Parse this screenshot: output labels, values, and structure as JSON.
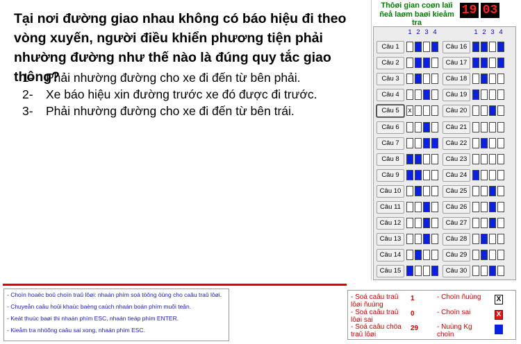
{
  "question": {
    "text": "Tại nơi đường giao nhau không có báo hiệu đi theo vòng xuyến, người điều khiển phương tiện phải nhường đường như thế nào là đúng quy tắc giao thông?",
    "answers": [
      {
        "num": "1-",
        "text": "Phải nhường đường cho xe đi đến từ bên phải."
      },
      {
        "num": "2-",
        "text": "Xe báo hiệu xin đường trước xe đó được đi trước."
      },
      {
        "num": "3-",
        "text": "Phải nhường đường cho xe đi đến từ bên trái."
      }
    ]
  },
  "timer": {
    "label": "Thôøi gian coøn laïi ñeå laøm baøi kieåm tra",
    "minutes": "19",
    "seconds": "03"
  },
  "grid": {
    "column_headers": [
      "1",
      "2",
      "3",
      "4"
    ],
    "questions": [
      {
        "label": "Câu 1",
        "cells": [
          "",
          "filled",
          "",
          "filled"
        ]
      },
      {
        "label": "Câu 2",
        "cells": [
          "",
          "filled",
          "filled",
          ""
        ]
      },
      {
        "label": "Câu 3",
        "cells": [
          "",
          "filled",
          "",
          ""
        ]
      },
      {
        "label": "Câu 4",
        "cells": [
          "",
          "",
          "filled",
          ""
        ]
      },
      {
        "label": "Câu 5",
        "cells": [
          "x",
          "",
          "",
          ""
        ],
        "active": true
      },
      {
        "label": "Câu 6",
        "cells": [
          "",
          "",
          "filled",
          ""
        ]
      },
      {
        "label": "Câu 7",
        "cells": [
          "",
          "",
          "filled",
          "filled"
        ]
      },
      {
        "label": "Câu 8",
        "cells": [
          "filled",
          "filled",
          "",
          ""
        ]
      },
      {
        "label": "Câu 9",
        "cells": [
          "filled",
          "filled",
          "",
          ""
        ]
      },
      {
        "label": "Câu 10",
        "cells": [
          "",
          "filled",
          "",
          ""
        ]
      },
      {
        "label": "Câu 11",
        "cells": [
          "",
          "",
          "filled",
          ""
        ]
      },
      {
        "label": "Câu 12",
        "cells": [
          "",
          "",
          "filled",
          ""
        ]
      },
      {
        "label": "Câu 13",
        "cells": [
          "",
          "",
          "filled",
          ""
        ]
      },
      {
        "label": "Câu 14",
        "cells": [
          "",
          "filled",
          "",
          ""
        ]
      },
      {
        "label": "Câu 15",
        "cells": [
          "filled",
          "",
          "",
          "filled"
        ]
      },
      {
        "label": "Câu 16",
        "cells": [
          "filled",
          "filled",
          "",
          "filled"
        ]
      },
      {
        "label": "Câu 17",
        "cells": [
          "filled",
          "filled",
          "",
          "filled"
        ]
      },
      {
        "label": "Câu 18",
        "cells": [
          "",
          "filled",
          "",
          ""
        ]
      },
      {
        "label": "Câu 19",
        "cells": [
          "filled",
          "",
          "",
          ""
        ]
      },
      {
        "label": "Câu 20",
        "cells": [
          "",
          "",
          "filled",
          ""
        ]
      },
      {
        "label": "Câu 21",
        "cells": [
          "",
          "",
          "",
          ""
        ]
      },
      {
        "label": "Câu 22",
        "cells": [
          "",
          "filled",
          "",
          ""
        ]
      },
      {
        "label": "Câu 23",
        "cells": [
          "",
          "",
          "",
          ""
        ]
      },
      {
        "label": "Câu 24",
        "cells": [
          "filled",
          "",
          "",
          ""
        ]
      },
      {
        "label": "Câu 25",
        "cells": [
          "",
          "",
          "filled",
          ""
        ]
      },
      {
        "label": "Câu 26",
        "cells": [
          "",
          "",
          "filled",
          ""
        ]
      },
      {
        "label": "Câu 27",
        "cells": [
          "",
          "",
          "filled",
          ""
        ]
      },
      {
        "label": "Câu 28",
        "cells": [
          "",
          "filled",
          "",
          ""
        ]
      },
      {
        "label": "Câu 29",
        "cells": [
          "",
          "filled",
          "",
          ""
        ]
      },
      {
        "label": "Câu 30",
        "cells": [
          "",
          "",
          "filled",
          ""
        ]
      }
    ]
  },
  "instructions": [
    "- Choïn hoaëc boû choïn traû lôøi: nhaán phím soá töông öùng cho caâu traû lôøi.",
    "- Chuyeån caâu hoûi khaùc baèng caùch nhaán boán phím muõi teân.",
    "- Keát thuùc baøi thi nhaán phím ESC, nhaán tieáp phím ENTER.",
    "- Kieåm tra nhöõng caâu sai xong, nhaán phím ESC."
  ],
  "stats": [
    {
      "label": "- Soá caâu traû lôøi ñuùng",
      "value": "1"
    },
    {
      "label": "- Soá caâu traû lôøi sai",
      "value": "0"
    },
    {
      "label": "- Soá caâu chöa traû lôøi",
      "value": "29"
    }
  ],
  "legend": [
    {
      "label": "- Choïn ñuùng",
      "symbol": "X",
      "kind": "chosen"
    },
    {
      "label": "- Choïn sai",
      "symbol": "X",
      "kind": "wrong"
    },
    {
      "label": "- Ñuùng Kg choïn",
      "symbol": "",
      "kind": "correct"
    }
  ],
  "colors": {
    "answer_fill": "#0a22e0",
    "timer_digits": "#ff2020",
    "timer_label": "#008000",
    "instruction_text": "#1818c8",
    "stat_text": "#d00000"
  }
}
